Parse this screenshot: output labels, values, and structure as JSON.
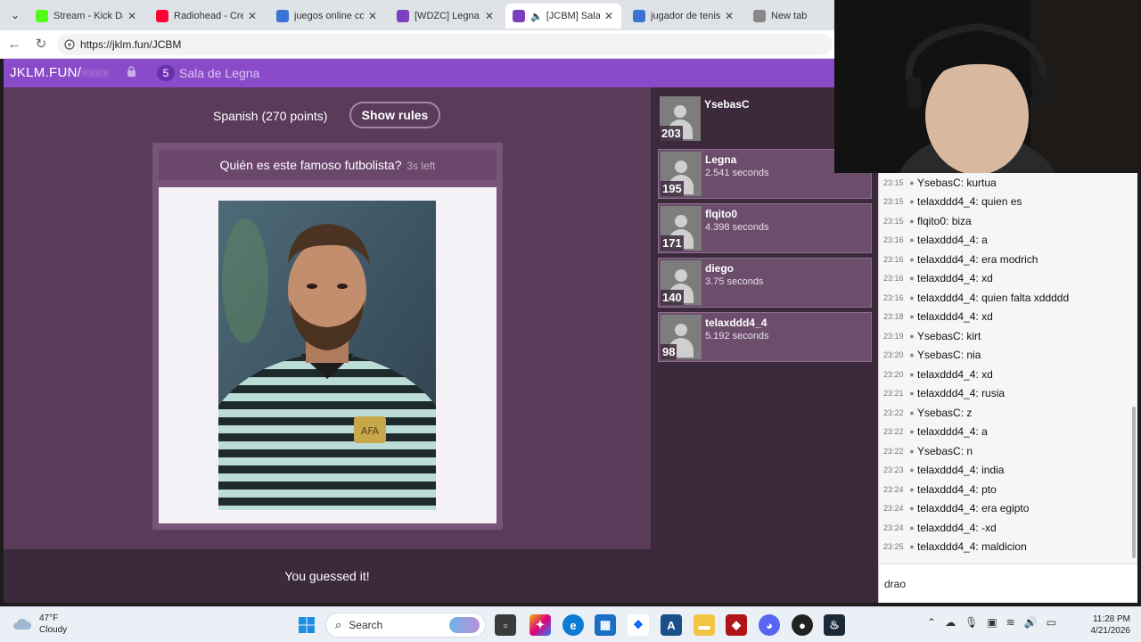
{
  "browser": {
    "tabs": [
      {
        "title": "Stream - Kick Dashb",
        "favicon": "kick-icon",
        "color": "#53fc18",
        "active": false
      },
      {
        "title": "Radiohead - Creep",
        "favicon": "youtube-icon",
        "color": "#ff0033",
        "active": false
      },
      {
        "title": "juegos online con a",
        "favicon": "search-icon",
        "color": "#3b73d6",
        "active": false
      },
      {
        "title": "[WDZC] Legna",
        "favicon": "jklm-icon",
        "color": "#7b3fbf",
        "active": false
      },
      {
        "title": "[JCBM] Sala de",
        "favicon": "jklm-icon",
        "color": "#7b3fbf",
        "active": true
      },
      {
        "title": "jugador de tenis - S",
        "favicon": "search-icon",
        "color": "#3b73d6",
        "active": false
      },
      {
        "title": "New tab",
        "favicon": "new-tab-icon",
        "color": "#888888",
        "active": false
      }
    ],
    "url": "https://jklm.fun/JCBM"
  },
  "site": {
    "logo": "JKLM.FUN/",
    "logo_hidden": "xxxx",
    "room_count": "5",
    "room_name": "Sala de Legna",
    "accent": "#8a4bc9"
  },
  "game": {
    "language_line": "Spanish (270 points)",
    "rules_button": "Show rules",
    "question": "Quién es este famoso futbolista?",
    "time_left": "3s left",
    "result": "You guessed it!"
  },
  "leaderboard": [
    {
      "name": "YsebasC",
      "score": "203",
      "time": ""
    },
    {
      "name": "Legna",
      "score": "195",
      "time": "2.541 seconds"
    },
    {
      "name": "flqito0",
      "score": "171",
      "time": "4.398 seconds"
    },
    {
      "name": "diego",
      "score": "140",
      "time": "3.75 seconds"
    },
    {
      "name": "telaxddd4_4",
      "score": "98",
      "time": "5.192 seconds"
    }
  ],
  "chat": {
    "messages": [
      {
        "time": "23:15",
        "user": "YsebasC",
        "text": "kurtua"
      },
      {
        "time": "23:15",
        "user": "telaxddd4_4",
        "text": "quien es"
      },
      {
        "time": "23:15",
        "user": "flqito0",
        "text": "biza"
      },
      {
        "time": "23:16",
        "user": "telaxddd4_4",
        "text": "a"
      },
      {
        "time": "23:16",
        "user": "telaxddd4_4",
        "text": "era modrich"
      },
      {
        "time": "23:16",
        "user": "telaxddd4_4",
        "text": "xd"
      },
      {
        "time": "23:16",
        "user": "telaxddd4_4",
        "text": "quien falta xddddd"
      },
      {
        "time": "23:18",
        "user": "telaxddd4_4",
        "text": "xd"
      },
      {
        "time": "23:19",
        "user": "YsebasC",
        "text": "kirt"
      },
      {
        "time": "23:20",
        "user": "YsebasC",
        "text": "nia"
      },
      {
        "time": "23:20",
        "user": "telaxddd4_4",
        "text": "xd"
      },
      {
        "time": "23:21",
        "user": "telaxddd4_4",
        "text": "rusia"
      },
      {
        "time": "23:22",
        "user": "YsebasC",
        "text": "z"
      },
      {
        "time": "23:22",
        "user": "telaxddd4_4",
        "text": "a"
      },
      {
        "time": "23:22",
        "user": "YsebasC",
        "text": "n"
      },
      {
        "time": "23:23",
        "user": "telaxddd4_4",
        "text": "india"
      },
      {
        "time": "23:24",
        "user": "telaxddd4_4",
        "text": "pto"
      },
      {
        "time": "23:24",
        "user": "telaxddd4_4",
        "text": "era egipto"
      },
      {
        "time": "23:24",
        "user": "telaxddd4_4",
        "text": "-xd"
      },
      {
        "time": "23:25",
        "user": "telaxddd4_4",
        "text": "maldicion"
      }
    ],
    "input_value": "drao"
  },
  "taskbar": {
    "temperature": "47°F",
    "condition": "Cloudy",
    "search_label": "Search",
    "time": "11:28 PM",
    "date": "4/21/2026"
  }
}
